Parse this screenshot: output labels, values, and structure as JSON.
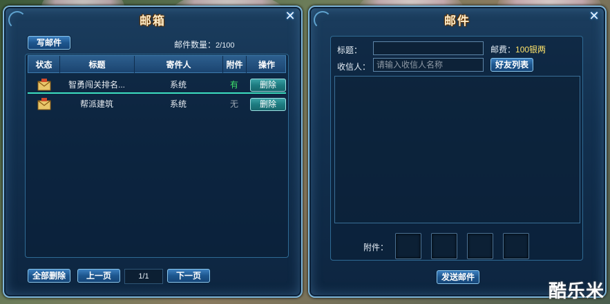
{
  "mailbox": {
    "title": "邮箱",
    "compose_label": "写邮件",
    "count_label": "邮件数量：",
    "count_value": "2/100",
    "columns": [
      "状态",
      "标题",
      "寄件人",
      "附件",
      "操作"
    ],
    "rows": [
      {
        "title": "智勇闯关排名...",
        "sender": "系统",
        "attachment": "有",
        "action": "删除",
        "selected": true
      },
      {
        "title": "帮派建筑",
        "sender": "系统",
        "attachment": "无",
        "action": "删除",
        "selected": false
      }
    ],
    "delete_all_label": "全部删除",
    "prev_label": "上一页",
    "page_value": "1/1",
    "next_label": "下一页"
  },
  "compose": {
    "title": "邮件",
    "subject_label": "标题：",
    "postage_label": "邮费：",
    "postage_value": "100银两",
    "recipient_label": "收信人：",
    "recipient_placeholder": "请输入收信人名称",
    "friends_label": "好友列表",
    "attachment_label": "附件：",
    "send_label": "发送邮件"
  },
  "watermark": "酷乐米",
  "colors": {
    "accent": "#7fb6d9",
    "has_attachment": "#3ee06a",
    "no_attachment": "#9aa6b2",
    "postage": "#ffe36a"
  },
  "icons": {
    "close": "close-icon",
    "status": "envelope-icon"
  }
}
